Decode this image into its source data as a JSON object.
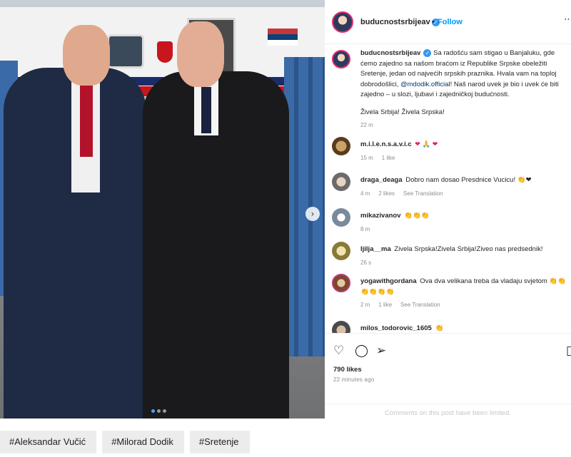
{
  "post": {
    "username": "buducnostsrbijeav",
    "follow_label": "Follow",
    "separator": "•",
    "more_icon": "ellipsis-icon",
    "caption": {
      "username": "buducnostsrbijeav",
      "text_before_mention": "Sa radošću sam stigao u Banjaluku, gde ćemo zajedno sa našom braćom iz Republike Srpske obeležiti Sretenje, jedan od najvećih srpskih praznika. Hvala vam na toploj dobrodošlici,",
      "mention": "@mdodik.official",
      "text_after_mention": "! Naš narod uvek je bio i uvek će biti zajedno – u slozi, ljubavi i zajedničkoj budućnosti.",
      "second_paragraph": "Živela Srbija! Živela Srpska!",
      "time": "22 m"
    },
    "comments": [
      {
        "username": "m.i.l.e.n.s.a.v.i.c",
        "text": "❤ 🙏 ❤",
        "time": "15 m",
        "likes": "1 like",
        "translation": ""
      },
      {
        "username": "draga_deaga",
        "text": "Dobro nam dosao Presdnice Vucicu! 👏❤",
        "time": "4 m",
        "likes": "2 likes",
        "translation": "See Translation"
      },
      {
        "username": "mikazivanov",
        "text": "👏👏👏",
        "time": "8 m",
        "likes": "",
        "translation": ""
      },
      {
        "username": "ljilja__ma",
        "text": "Zivela Srpska!Zivela Srbija!Ziveo nas predsednik!",
        "time": "26 s",
        "likes": "",
        "translation": ""
      },
      {
        "username": "yogawithgordana",
        "text": "Ova dva velikana treba da vladaju svjetom 👏👏👏👏👏👏",
        "time": "2 m",
        "likes": "1 like",
        "translation": "See Translation"
      },
      {
        "username": "milos_todorovic_1605",
        "text": "👏",
        "time": "",
        "likes": "",
        "translation": ""
      }
    ],
    "likes_count": "790 likes",
    "posted_ago": "22 minutes ago",
    "comments_limited": "Comments on this post have been limited.",
    "action_icons": [
      "heart-icon",
      "comment-icon",
      "share-icon",
      "bookmark-icon"
    ],
    "carousel": {
      "slides": 3,
      "active_index": 0
    }
  },
  "hashtags": [
    "#Aleksandar Vučić",
    "#Milorad Dodik",
    "#Sretenje"
  ]
}
